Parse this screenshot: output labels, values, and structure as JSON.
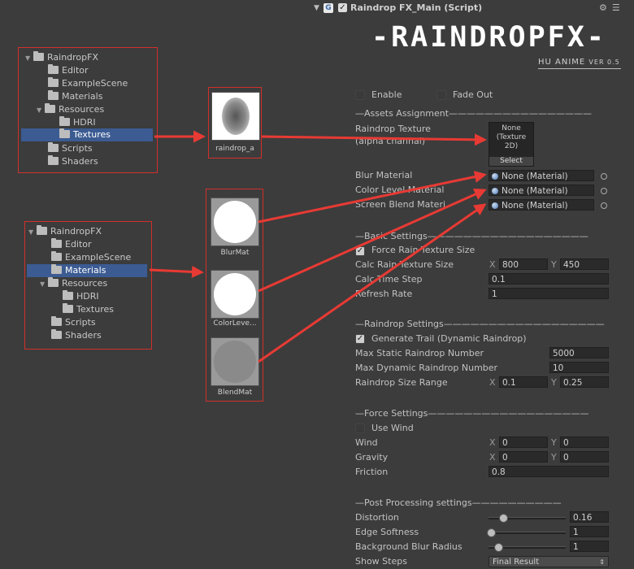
{
  "header": {
    "title": "Raindrop FX_Main (Script)",
    "logo": "-RAINDROPFX-",
    "author": "HU ANIME",
    "version": "VER 0.5",
    "script_icon": "G"
  },
  "tree1": {
    "items": [
      {
        "label": "RaindropFX"
      },
      {
        "label": "Editor"
      },
      {
        "label": "ExampleScene"
      },
      {
        "label": "Materials"
      },
      {
        "label": "Resources"
      },
      {
        "label": "HDRI"
      },
      {
        "label": "Textures"
      },
      {
        "label": "Scripts"
      },
      {
        "label": "Shaders"
      }
    ],
    "selected": "Textures"
  },
  "tree2": {
    "items": [
      {
        "label": "RaindropFX"
      },
      {
        "label": "Editor"
      },
      {
        "label": "ExampleScene"
      },
      {
        "label": "Materials"
      },
      {
        "label": "Resources"
      },
      {
        "label": "HDRI"
      },
      {
        "label": "Textures"
      },
      {
        "label": "Scripts"
      },
      {
        "label": "Shaders"
      }
    ],
    "selected": "Materials"
  },
  "assets": {
    "texture": "raindrop_a",
    "materials": [
      "BlurMat",
      "ColorLeve...",
      "BlendMat"
    ]
  },
  "inspector": {
    "enable_label": "Enable",
    "enable_checked": false,
    "fadeout_label": "Fade Out",
    "fadeout_checked": false,
    "sections": {
      "assets": "—Assets Assignment————————————————",
      "basic": "—Basic Settings——————————————————",
      "raindrop": "—Raindrop Settings——————————————————",
      "force": "—Force Settings——————————————————",
      "post": "—Post Processing settings——————————"
    },
    "raindrop_texture_label": "Raindrop Texture",
    "raindrop_texture_sub": "(alpha channal)",
    "texture_slot_lines": [
      "None",
      "(Texture",
      "2D)"
    ],
    "texture_select": "Select",
    "blur_material_label": "Blur Material",
    "blur_material_value": "None (Material)",
    "color_level_label": "Color Level Material",
    "color_level_value": "None (Material)",
    "screen_blend_label": "Screen Blend Materi",
    "screen_blend_value": "None (Material)",
    "force_rain_label": "Force Rain Texture Size",
    "force_rain_checked": true,
    "calc_rain_label": "Calc Rain Texture Size",
    "calc_rain_x": "800",
    "calc_rain_y": "450",
    "calc_time_label": "Calc Time Step",
    "calc_time_value": "0.1",
    "refresh_label": "Refresh Rate",
    "refresh_value": "1",
    "gen_trail_label": "Generate Trail (Dynamic Raindrop)",
    "gen_trail_checked": true,
    "max_static_label": "Max Static Raindrop Number",
    "max_static_value": "5000",
    "max_dynamic_label": "Max Dynamic Raindrop Number",
    "max_dynamic_value": "10",
    "size_range_label": "Raindrop Size Range",
    "size_range_x": "0.1",
    "size_range_y": "0.25",
    "use_wind_label": "Use Wind",
    "use_wind_checked": false,
    "wind_label": "Wind",
    "wind_x": "0",
    "wind_y": "0",
    "gravity_label": "Gravity",
    "gravity_x": "0",
    "gravity_y": "0",
    "friction_label": "Friction",
    "friction_value": "0.8",
    "distortion_label": "Distortion",
    "distortion_value": "0.16",
    "distortion_level": 0.16,
    "edge_softness_label": "Edge Softness",
    "edge_softness_value": "1",
    "edge_softness_level": 0.0,
    "bg_blur_label": "Background Blur Radius",
    "bg_blur_value": "1",
    "bg_blur_level": 0.1,
    "show_steps_label": "Show Steps",
    "show_steps_value": "Final Result",
    "axis_x": "X",
    "axis_y": "Y"
  },
  "colors": {
    "annotation_red": "#d2302b",
    "selection_blue": "#3b5b92",
    "background": "#3c3c3c"
  }
}
